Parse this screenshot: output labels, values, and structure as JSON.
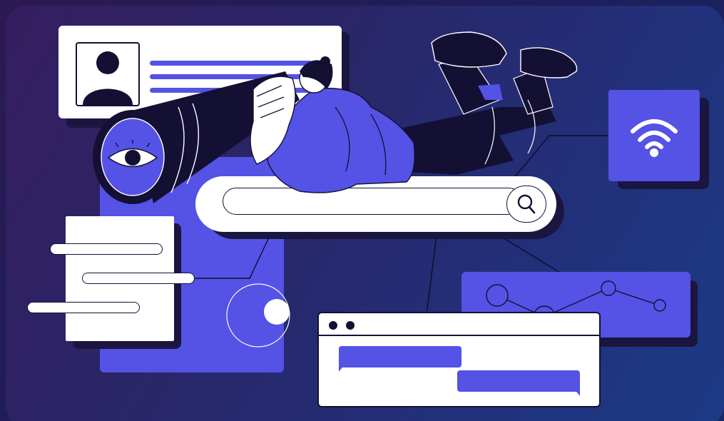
{
  "illustration": {
    "colors": {
      "background_dark": "#1f1d5a",
      "accent_purple": "#5552e6",
      "card_white": "#ffffff",
      "ink_navy": "#141034"
    },
    "profile_card": {
      "icon": "user-avatar-icon",
      "lines": 3
    },
    "search_bar": {
      "icon": "search-icon",
      "value": ""
    },
    "wifi_tile": {
      "icon": "wifi-icon"
    },
    "line_chart_card": {
      "points": 4
    },
    "chat_window": {
      "window_dots": 2,
      "bubbles": 2
    },
    "document_card": {
      "lines": 3
    },
    "telescope": {
      "icon": "eye-icon"
    }
  }
}
